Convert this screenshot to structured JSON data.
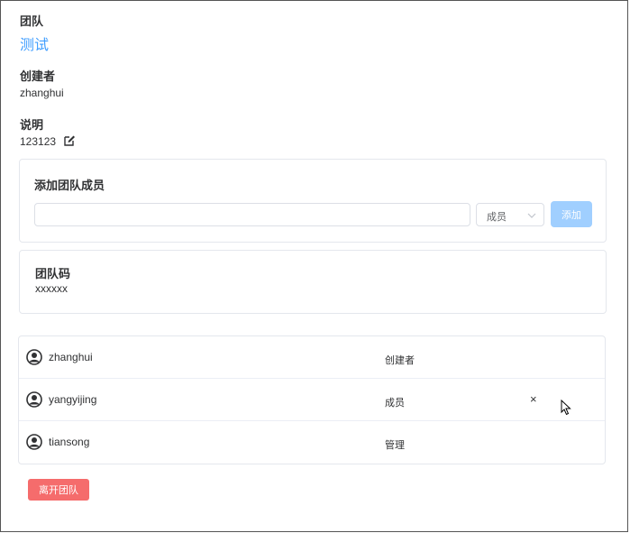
{
  "team": {
    "label": "团队",
    "name": "测试"
  },
  "creator": {
    "label": "创建者",
    "value": "zhanghui"
  },
  "description": {
    "label": "说明",
    "value": "123123"
  },
  "add_member": {
    "title": "添加团队成员",
    "input_value": "",
    "role_selected": "成员",
    "add_label": "添加"
  },
  "team_code": {
    "title": "团队码",
    "value": "xxxxxx"
  },
  "members": [
    {
      "name": "zhanghui",
      "role": "创建者"
    },
    {
      "name": "yangyijing",
      "role": "成员",
      "remove": "×"
    },
    {
      "name": "tiansong",
      "role": "管理"
    }
  ],
  "leave_label": "离开团队",
  "colors": {
    "primary": "#409eff",
    "primary_disabled": "#a0cfff",
    "danger": "#f56c6c"
  }
}
